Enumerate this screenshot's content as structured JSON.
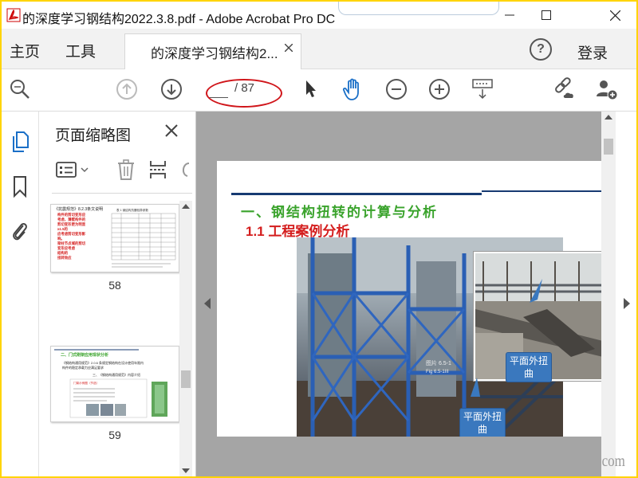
{
  "window": {
    "title": "的深度学习钢结构2022.3.8.pdf - Adobe Acrobat Pro DC",
    "controls": [
      "minimize",
      "maximize",
      "close"
    ]
  },
  "menubar": {
    "home": "主页",
    "tools": "工具",
    "tab_label": "的深度学习钢结构2...",
    "help": "?",
    "login": "登录"
  },
  "toolbar": {
    "page_current": "",
    "page_total": "/ 87",
    "annotation_color": "#d0151a"
  },
  "sidebar": {
    "title": "页面缩略图",
    "thumbnails": [
      {
        "number": "58"
      },
      {
        "number": "59"
      }
    ]
  },
  "thumb58": {
    "heading": "《抗震规范》8.2.3条文说明",
    "red_lines": [
      "构件的剪切变形应",
      "考虑，薄壁构件的",
      "剪切变形更为明显",
      "≥1.5的",
      "应考虑剪切变形影",
      "响。",
      "梁柱节点域的剪切",
      "变形应考虑",
      "结构的",
      "扭转效应"
    ],
    "table_caption": "表 1 钢结构抗震验算参数"
  },
  "thumb59": {
    "heading": "二、门式刚架应用现状分析",
    "line1": "《钢结构通用规范》2.0.6 条规定钢结构在设计使用年限内",
    "line2": "构件的稳定承载力应满足要求",
    "sub": "三、《钢结构通用规范》内容介绍",
    "box": "门架示例图（节选）"
  },
  "page": {
    "heading": "一、钢结构扭转的计算与分析",
    "subheading": "1.1 工程案例分析",
    "callout_1": "平面外扭曲",
    "callout_2": "平面外扭曲",
    "figure_note": "图片 6.5-1",
    "figure_note_2": "Fig 6.5-1III",
    "colors": {
      "heading": "#3aa32c",
      "subheading": "#d41d1d",
      "rule": "#173a72",
      "callout": "#3a78be"
    }
  },
  "watermark": "com"
}
